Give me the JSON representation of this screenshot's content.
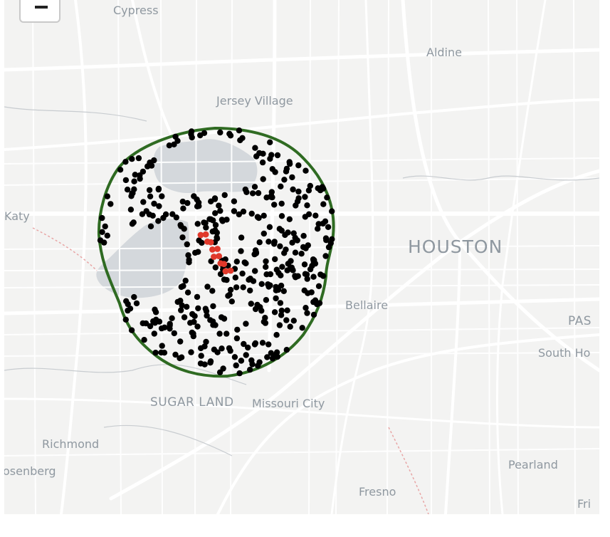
{
  "zoom_control": {
    "zoom_out_label": "−"
  },
  "places": {
    "cypress": "Cypress",
    "aldine": "Aldine",
    "jersey_village": "Jersey Village",
    "katy": "Katy",
    "houston": "HOUSTON",
    "bellaire": "Bellaire",
    "pasadena": "PAS",
    "south_houston": "South Ho",
    "sugar_land": "SUGAR LAND",
    "missouri_city": "Missouri City",
    "richmond": "Richmond",
    "rosenberg": "osenberg",
    "pearland": "Pearland",
    "fresno": "Fresno",
    "friendswood": "Fri"
  },
  "colors": {
    "boundary": "#2f6b22",
    "point_default": "#000000",
    "point_highlight": "#e0392b",
    "reservoir": "#d4d8dc",
    "road": "#ffffff",
    "label": "#8f98a0"
  },
  "legend_counts": {
    "black_points": 420,
    "red_points": 12
  }
}
